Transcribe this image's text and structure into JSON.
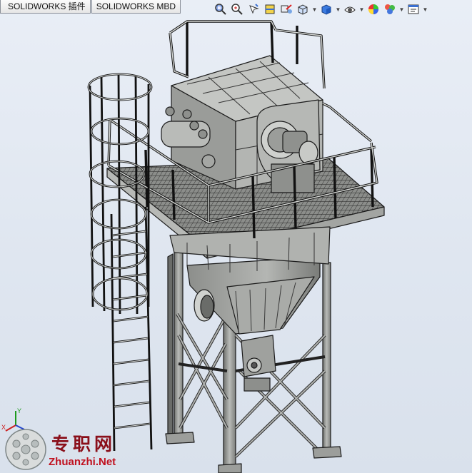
{
  "tabs": [
    {
      "label": "SOLIDWORKS 插件"
    },
    {
      "label": "SOLIDWORKS MBD"
    }
  ],
  "heads_up_toolbar": {
    "tools": [
      {
        "icon": "zoom-to-fit-icon"
      },
      {
        "icon": "zoom-to-area-icon"
      },
      {
        "icon": "previous-view-icon"
      },
      {
        "icon": "section-view-icon"
      },
      {
        "icon": "dynamic-annotation-views-icon"
      },
      {
        "icon": "view-orientation-icon"
      },
      {
        "icon": "display-style-icon"
      },
      {
        "icon": "hide-show-items-icon"
      },
      {
        "icon": "edit-appearance-icon"
      },
      {
        "icon": "apply-scene-icon"
      },
      {
        "icon": "view-settings-icon"
      }
    ]
  },
  "triad": {
    "x_label": "X",
    "y_label": "Y",
    "z_label": "Z"
  },
  "watermark": {
    "chinese": "专职网",
    "url": "Zhuanzhi.Net"
  },
  "colors": {
    "background_top": "#e9eef6",
    "model_steel": "#a8aaa7",
    "edge": "#1a1a1a",
    "watermark_red": "#c0111f"
  }
}
